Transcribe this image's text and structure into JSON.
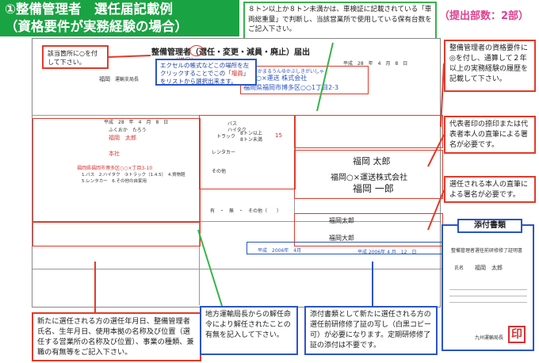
{
  "header": {
    "title_line1": "①整備管理者　選任届記載例",
    "title_line2": "（資格要件が実務経験の場合）",
    "submit_count": "（提出部数：2部）"
  },
  "notes": {
    "top_center": "８トン以上か８トン未満かは、車検証に記載されている「車両総重量」で判断し、当該営業所で使用している保有台数をご記入下さい。",
    "box_left": "該当箇所に○を付して下さい。",
    "excel_tip_a": "エクセルの帳式などこの場所を左クリックすることでこの「",
    "excel_tip_b": "増員",
    "excel_tip_c": "」をリストから選択出来ます。",
    "right_top": "整備管理者の資格要件に◎を付し、通算して２年以上の実務経験の履歴を記載して下さい。",
    "right_mid": "代表者印の捺印または代表者本人の直筆による署名が必要です。",
    "right_low": "選任される本人の直筆による署名が必要です。",
    "bottom_left": "新たに選任される方の選任年月日、整備管理者氏名、生年月日、使用本拠の名称及び位置（選任する営業所の名称及び位置）、事業の種類、兼職の有無等をご記入下さい。",
    "bottom_mid": "地方運輸局長からの解任命令により解任されたことの有無を記入して下さい。",
    "bottom_right": "添付書類として新たに選任される方の選任前研修修了証の写し（白黒コピー可）が必要になります。定期研修修了証の添付は不要です。"
  },
  "form": {
    "heading": "整備管理者（選任・変更・減員・廃止）届出",
    "option_selected": "（増員）",
    "date_line": "平成　28　年　4　月　8　日",
    "furigana": "ふくおかまるうんゆかぶしきがいしゃ",
    "company": "福岡○×運送 株式会社",
    "address": "福岡県福岡市博多区○○1丁目2-3",
    "office": "福岡",
    "office_suffix": "運輸支局長",
    "selection_date": "平成　28　年　4　月　8　日",
    "manager_name_kana": "ふくおか　たろう",
    "manager_name": "福岡　太郎",
    "base_name": "本社",
    "base_address": "福岡県福岡市博多区○○×丁目3-10",
    "business_types": "1.バス　2.ハイタク　③トラック（1.4.5）　4.貨物軽　5.レンタカー　6.その他の自家用",
    "vehicles": {
      "bus": "バス",
      "taxi": "ハイタク",
      "truck": "トラック",
      "rentacar": "レンタカー",
      "other": "その他"
    },
    "truck_over8": "8トン以上",
    "truck_under8": "8トン未満",
    "truck_count": "15",
    "signature_company": "福岡 太郎",
    "signature_rep": "福岡○×運送株式会社",
    "signature_person": "福岡 一郎",
    "attach_date": "平成　2006年　4月",
    "additional_date": "平成 2006年 4 月　12　日",
    "dismissal_options": "有　・　無　・　その他（　　）",
    "sig_small_1": "福岡太郎",
    "sig_small_2": "福岡大郎"
  },
  "attachment": {
    "label": "添付書類",
    "doc_title": "整備管理者選任前研修修了証明書",
    "name_label": "氏名",
    "name_value": "福岡　太郎",
    "issuer": "九州運輸局長",
    "seal": "印"
  },
  "colors": {
    "green": "#1aa343",
    "red": "#e23a2a",
    "blue": "#2a55c8",
    "pink": "#e0408f"
  }
}
